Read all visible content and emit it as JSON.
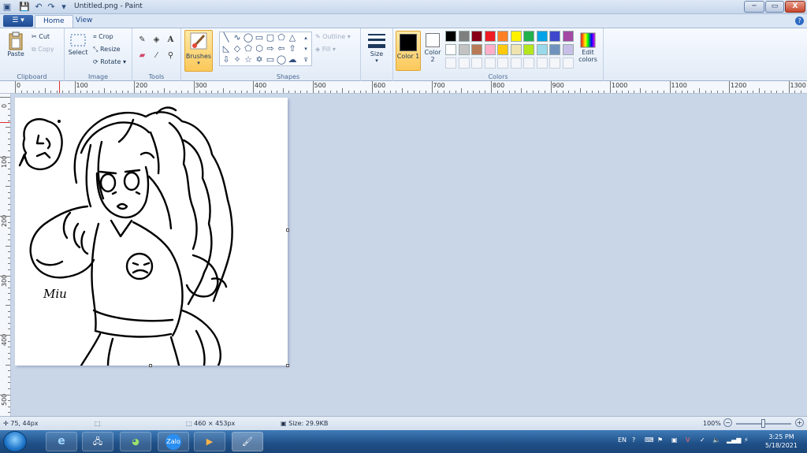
{
  "window": {
    "title": "Untitled.png - Paint",
    "controls": {
      "minimize": "─",
      "maximize": "▭",
      "close": "X"
    }
  },
  "tabs": {
    "home": "Home",
    "view": "View"
  },
  "ribbon": {
    "clipboard": {
      "label": "Clipboard",
      "paste": "Paste",
      "cut": "Cut",
      "copy": "Copy"
    },
    "image": {
      "label": "Image",
      "select": "Select",
      "crop": "Crop",
      "resize": "Resize",
      "rotate": "Rotate"
    },
    "tools": {
      "label": "Tools"
    },
    "brushes": {
      "label": "Brushes"
    },
    "shapes": {
      "label": "Shapes",
      "outline": "Outline",
      "fill": "Fill"
    },
    "size": {
      "label": "Size"
    },
    "colors": {
      "label": "Colors",
      "color1": "Color 1",
      "color2": "Color 2",
      "edit": "Edit colors",
      "color1_value": "#000000",
      "color2_value": "#ffffff",
      "palette_row1": [
        "#000000",
        "#7f7f7f",
        "#880015",
        "#ed1c24",
        "#ff7f27",
        "#fff200",
        "#22b14c",
        "#00a2e8",
        "#3f48cc",
        "#a349a4"
      ],
      "palette_row2": [
        "#ffffff",
        "#c3c3c3",
        "#b97a57",
        "#ffaec9",
        "#ffc90e",
        "#efe4b0",
        "#b5e61d",
        "#99d9ea",
        "#7092be",
        "#c8bfe7"
      ]
    }
  },
  "ruler": {
    "top": [
      "0",
      "100",
      "200",
      "300",
      "400",
      "500",
      "600",
      "700",
      "800",
      "900",
      "1000",
      "1100",
      "1200",
      "1300"
    ],
    "left": [
      "0",
      "100",
      "200",
      "300",
      "400",
      "500"
    ]
  },
  "canvas": {
    "signature": "Miu"
  },
  "status": {
    "cursor": "75, 44px",
    "canvas_size": "460 × 453px",
    "file_size": "Size: 29.9KB",
    "zoom": "100%"
  },
  "taskbar": {
    "apps": [
      "ie-icon",
      "network-icon",
      "coccoc-icon",
      "zalo-icon",
      "media-icon",
      "paint-icon"
    ],
    "zalo_label": "Zalo",
    "lang": "EN",
    "time": "3:25 PM",
    "date": "5/18/2021"
  }
}
